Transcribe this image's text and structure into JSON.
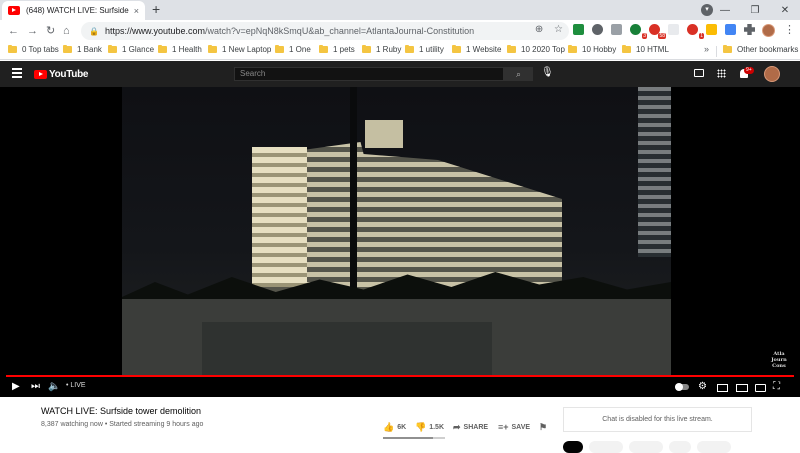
{
  "browser": {
    "tab_title": "(648) WATCH LIVE: Surfside tower demolition",
    "tab_close": "×",
    "new_tab": "+",
    "url_main": "https://www.youtube.com",
    "url_rest": "/watch?v=epNqN8kSmqU&ab_channel=AtlantaJournal-Constitution",
    "nav": {
      "back": "←",
      "forward": "→",
      "reload": "↻",
      "home": "⌂"
    },
    "window": {
      "minimize": "—",
      "maximize": "❐",
      "close": "✕"
    },
    "profile_letter": "▾",
    "menu": "⋮",
    "ext_badges": {
      "ext4": "3",
      "ext5": "58",
      "ext7": "1"
    }
  },
  "bookmarks": [
    "0 Top tabs",
    "1 Bank",
    "1 Glance",
    "1 Health",
    "1 New Laptop",
    "1 One",
    "1 pets",
    "1 Ruby",
    "1 utility",
    "1 Website",
    "10 2020 Top",
    "10 Hobby",
    "10 HTML"
  ],
  "bookmarks_more": "»",
  "other_bookmarks": "Other bookmarks",
  "youtube": {
    "logo_text": "YouTube",
    "search_placeholder": "Search",
    "search_icon": "⌕",
    "notif_count": "9+",
    "watermark": "Atlanta Journal-Constitution"
  },
  "player": {
    "live_label": "• LIVE",
    "progress_fraction": 1.0
  },
  "video": {
    "title": "WATCH LIVE: Surfside tower demolition",
    "meta": "8,387 watching now • Started streaming 9 hours ago",
    "likes": "6K",
    "dislikes": "1.5K",
    "share": "SHARE",
    "save": "SAVE",
    "like_ratio": 0.8,
    "chat_disabled": "Chat is disabled for this live stream."
  }
}
